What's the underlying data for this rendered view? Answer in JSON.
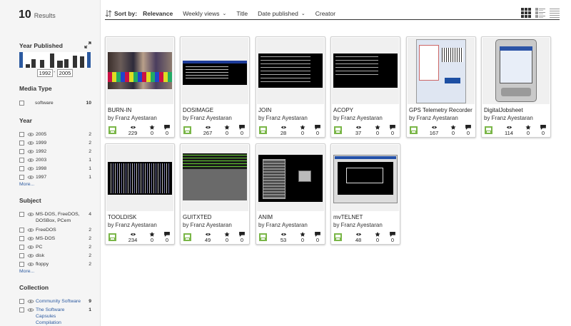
{
  "results": {
    "count": "10",
    "label": "Results"
  },
  "sidebar": {
    "year_published": {
      "title": "Year Published",
      "from": "1992",
      "to": "2005",
      "histogram": [
        0.25,
        0.6,
        0.55,
        1.0,
        0.5,
        0.6,
        0.85,
        0.8
      ]
    },
    "media_type": {
      "title": "Media Type",
      "items": [
        {
          "label": "software",
          "count": "10"
        }
      ]
    },
    "year": {
      "title": "Year",
      "items": [
        {
          "label": "2005",
          "count": "2"
        },
        {
          "label": "1999",
          "count": "2"
        },
        {
          "label": "1992",
          "count": "2"
        },
        {
          "label": "2003",
          "count": "1"
        },
        {
          "label": "1998",
          "count": "1"
        },
        {
          "label": "1997",
          "count": "1"
        }
      ],
      "more": "More..."
    },
    "subject": {
      "title": "Subject",
      "items": [
        {
          "label": "MS-DOS, FreeDOS, DOSBox, PCem",
          "count": "4"
        },
        {
          "label": "FreeDOS",
          "count": "2"
        },
        {
          "label": "MS-DOS",
          "count": "2"
        },
        {
          "label": "PC",
          "count": "2"
        },
        {
          "label": "disk",
          "count": "2"
        },
        {
          "label": "floppy",
          "count": "2"
        }
      ],
      "more": "More..."
    },
    "collection": {
      "title": "Collection",
      "items": [
        {
          "label": "Community Software",
          "count": "9"
        },
        {
          "label": "The Software Capsules Compilation",
          "count": "1"
        }
      ]
    }
  },
  "sortbar": {
    "label": "Sort by:",
    "options": [
      "Relevance",
      "Weekly views",
      "Title",
      "Date published",
      "Creator"
    ],
    "active": "Relevance"
  },
  "tiles": [
    {
      "title": "BURN-IN",
      "creator": "by Franz Ayestaran",
      "views": "229",
      "favorites": "0",
      "reviews": "0"
    },
    {
      "title": "DOSIMAGE",
      "creator": "by Franz Ayestaran",
      "views": "267",
      "favorites": "0",
      "reviews": "0"
    },
    {
      "title": "JOIN",
      "creator": "by Franz Ayestaran",
      "views": "28",
      "favorites": "0",
      "reviews": "0"
    },
    {
      "title": "ACOPY",
      "creator": "by Franz Ayestaran",
      "views": "37",
      "favorites": "0",
      "reviews": "0"
    },
    {
      "title": "GPS Telemetry Recorder",
      "creator": "by Franz Ayestaran",
      "views": "167",
      "favorites": "0",
      "reviews": "0"
    },
    {
      "title": "DigitalJobsheet",
      "creator": "by Franz Ayestaran",
      "views": "114",
      "favorites": "0",
      "reviews": "0"
    },
    {
      "title": "TOOLDISK",
      "creator": "by Franz Ayestaran",
      "views": "234",
      "favorites": "0",
      "reviews": "0"
    },
    {
      "title": "GUITXTED",
      "creator": "by Franz Ayestaran",
      "views": "49",
      "favorites": "0",
      "reviews": "0"
    },
    {
      "title": "ANIM",
      "creator": "by Franz Ayestaran",
      "views": "53",
      "favorites": "0",
      "reviews": "0"
    },
    {
      "title": "mvTELNET",
      "creator": "by Franz Ayestaran",
      "views": "48",
      "favorites": "0",
      "reviews": "0"
    }
  ],
  "colors": {
    "accent": "#2c5aa0",
    "software": "#7ab648",
    "text": "#333333"
  }
}
